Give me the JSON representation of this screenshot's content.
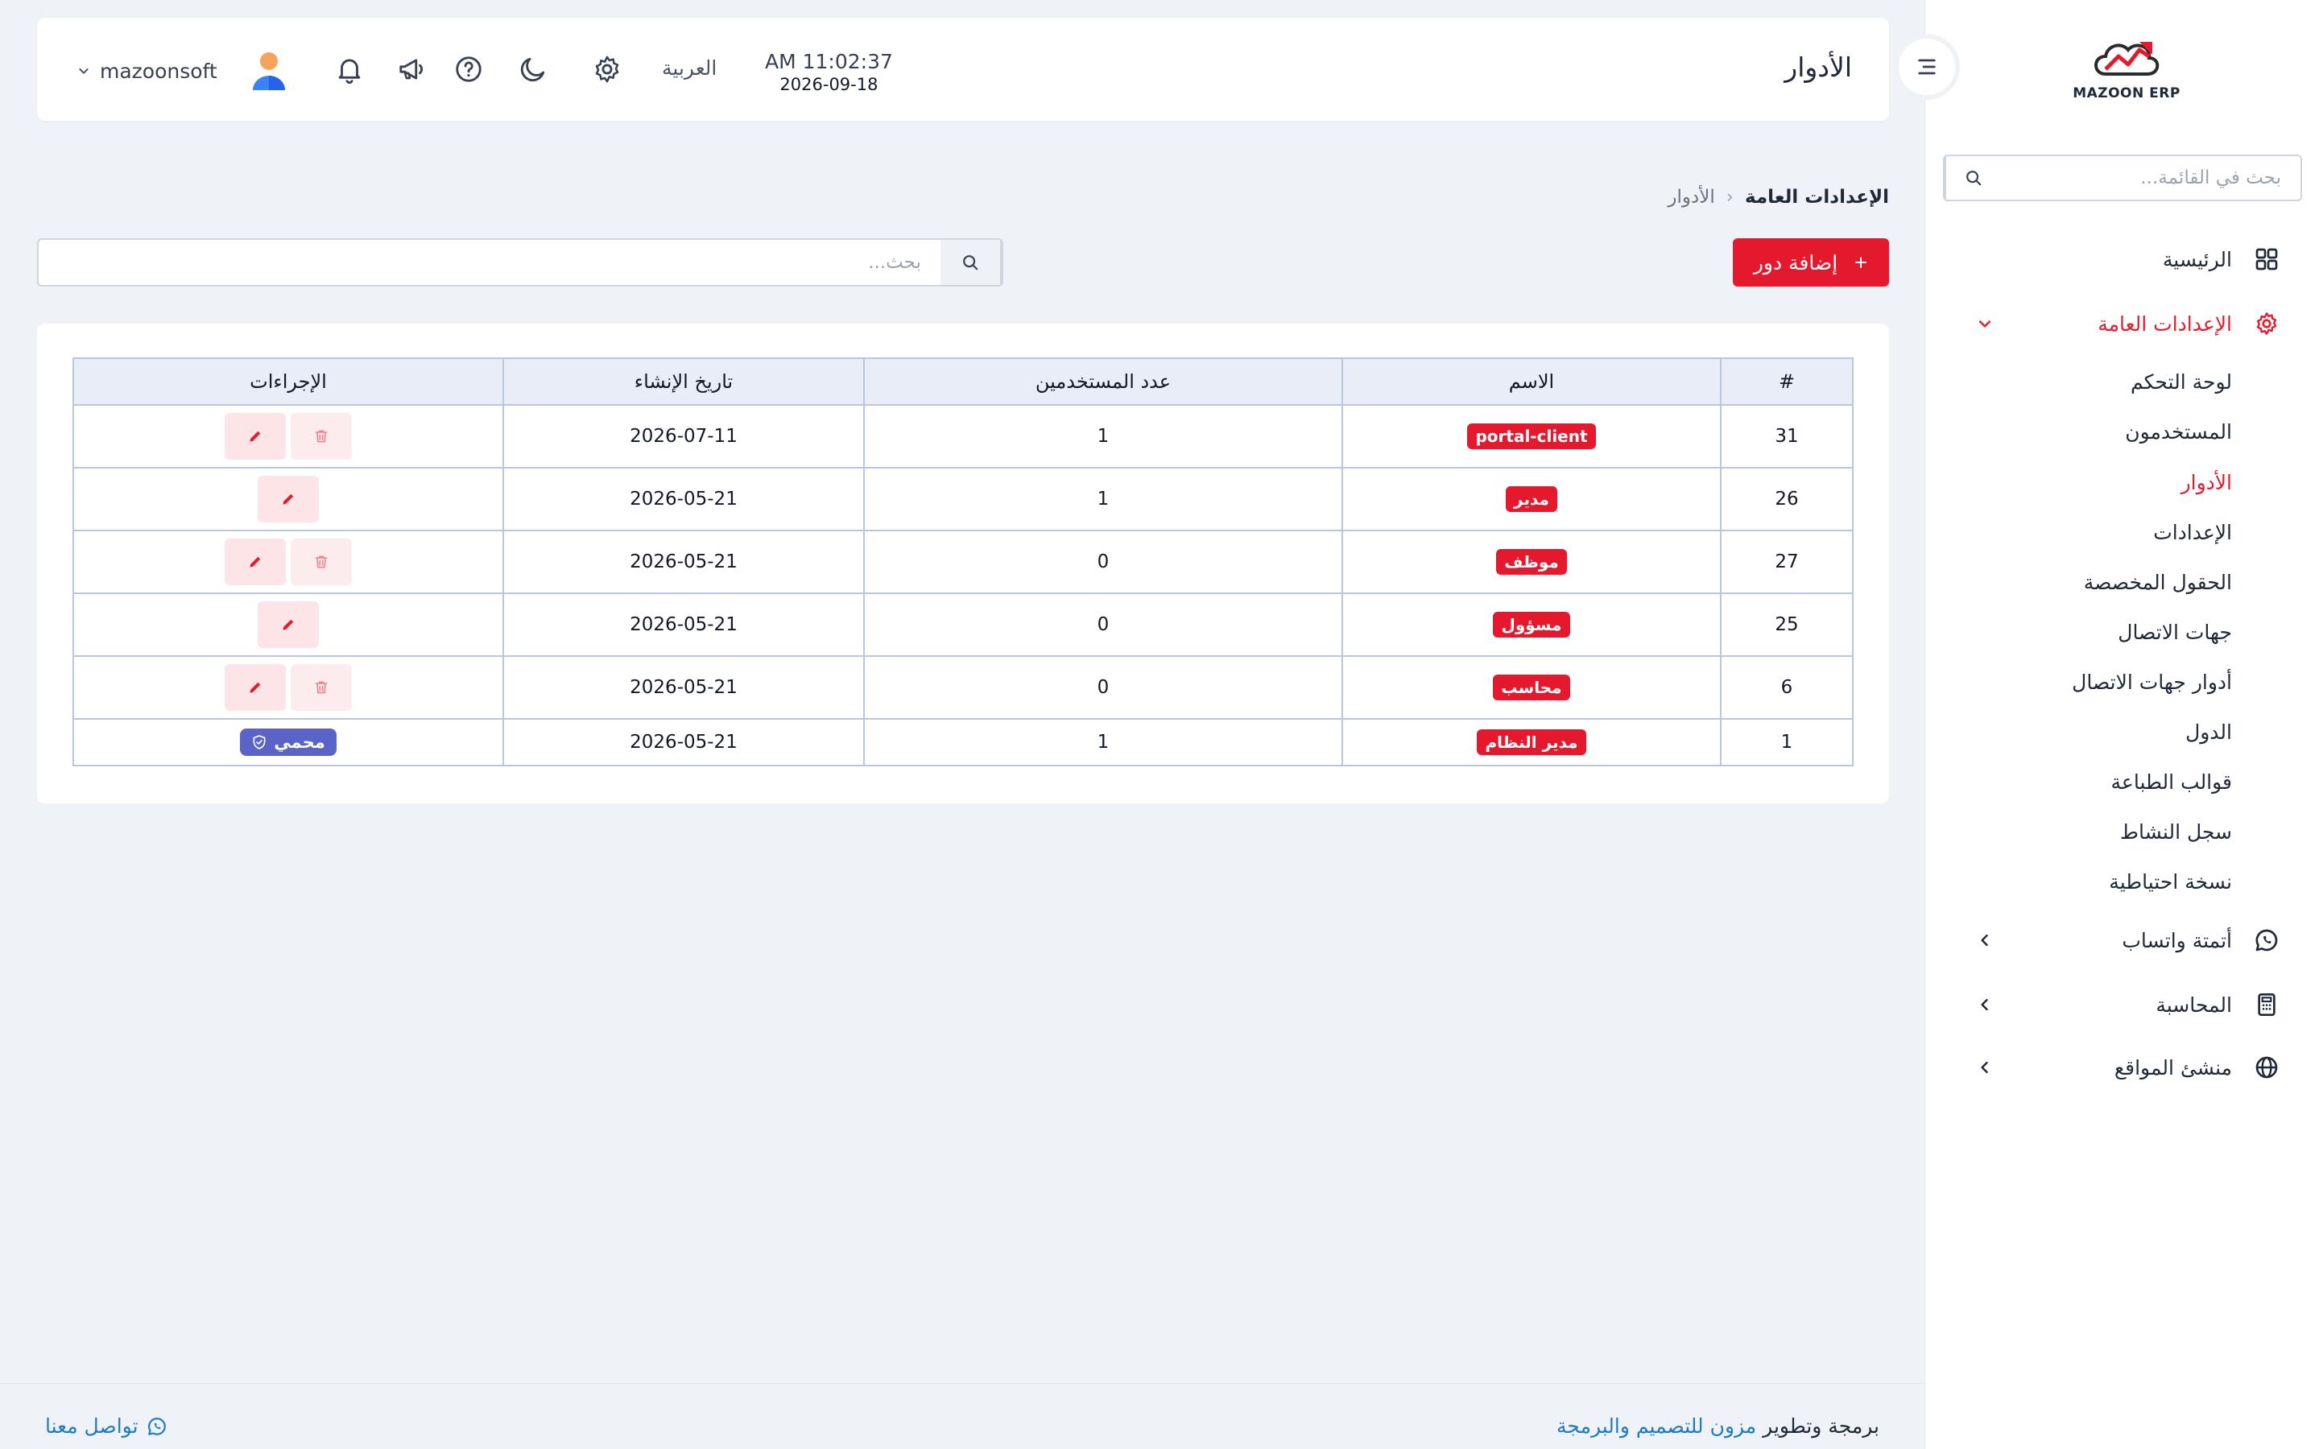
{
  "sidebar": {
    "logo_text": "MAZOON ERP",
    "search_placeholder": "بحث في القائمة...",
    "items": {
      "home": "الرئيسية",
      "general_settings": "الإعدادات العامة",
      "whatsapp": "أتمتة واتساب",
      "accounting": "المحاسبة",
      "site_builder": "منشئ المواقع"
    },
    "sub_items": [
      "لوحة التحكم",
      "المستخدمون",
      "الأدوار",
      "الإعدادات",
      "الحقول المخصصة",
      "جهات الاتصال",
      "أدوار جهات الاتصال",
      "الدول",
      "قوالب الطباعة",
      "سجل النشاط",
      "نسخة احتياطية"
    ],
    "active_sub_item": "الأدوار"
  },
  "header": {
    "title": "الأدوار",
    "time": "AM 11:02:37",
    "date": "2026-09-18",
    "language": "العربية",
    "username": "mazoonsoft"
  },
  "breadcrumb": {
    "parent": "الإعدادات العامة",
    "separator": "›",
    "current": "الأدوار"
  },
  "toolbar": {
    "add_label": "إضافة دور",
    "search_placeholder": "بحث..."
  },
  "table": {
    "headers": {
      "id": "#",
      "name": "الاسم",
      "users": "عدد المستخدمين",
      "created": "تاريخ الإنشاء",
      "actions": "الإجراءات"
    },
    "rows": [
      {
        "id": "31",
        "name": "portal-client",
        "users": "1",
        "created": "2026-07-11"
      },
      {
        "id": "26",
        "name": "مدير",
        "users": "1",
        "created": "2026-05-21"
      },
      {
        "id": "27",
        "name": "موظف",
        "users": "0",
        "created": "2026-05-21"
      },
      {
        "id": "25",
        "name": "مسؤول",
        "users": "0",
        "created": "2026-05-21"
      },
      {
        "id": "6",
        "name": "محاسب",
        "users": "0",
        "created": "2026-05-21"
      },
      {
        "id": "1",
        "name": "مدير النظام",
        "users": "1",
        "created": "2026-05-21"
      }
    ],
    "protected_label": "محمي"
  },
  "footer": {
    "credit_prefix": "برمجة وتطوير",
    "credit_link": "مزون للتصميم والبرمجة",
    "contact": "تواصل معنا"
  },
  "colors": {
    "accent": "#e5192e",
    "protected_badge": "#5a64c8",
    "link": "#1d7cc4"
  }
}
